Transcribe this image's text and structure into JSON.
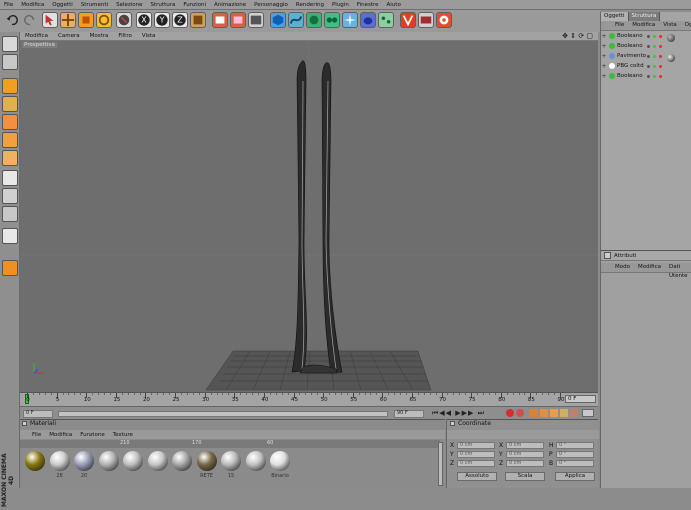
{
  "menubar": [
    "File",
    "Modifica",
    "Oggetti",
    "Strumenti",
    "Selezione",
    "Struttura",
    "Funzioni",
    "Animazione",
    "Personaggio",
    "Rendering",
    "Plugin",
    "Finestre",
    "Aiuto"
  ],
  "viewport": {
    "menu": [
      "Modifica",
      "Camera",
      "Mostra",
      "Filtro",
      "Vista"
    ],
    "label": "Prospettiva"
  },
  "timeline": {
    "ticks": [
      "0",
      "5",
      "10",
      "15",
      "20",
      "25",
      "30",
      "35",
      "40",
      "45",
      "50",
      "55",
      "60",
      "65",
      "70",
      "75",
      "80",
      "85",
      "90"
    ],
    "current_frame": "0 F",
    "start_frame": "0 F",
    "end_frame": "90 F"
  },
  "materials": {
    "title": "Materiali",
    "menu": [
      "File",
      "Modifica",
      "Funzione",
      "Texture"
    ],
    "items": [
      {
        "name": "",
        "color": "#8a7a10"
      },
      {
        "name": "28",
        "color": "#cccccc"
      },
      {
        "name": "20",
        "color": "#9aa0b8"
      },
      {
        "name": "",
        "color": "#b5b5b5"
      },
      {
        "name": "",
        "color": "#c0c0c0"
      },
      {
        "name": "",
        "color": "#c8c8c8"
      },
      {
        "name": "",
        "color": "#a9a9a9"
      },
      {
        "name": "RETE",
        "color": "#7a6a48"
      },
      {
        "name": "15",
        "color": "#bcbcbc"
      },
      {
        "name": "",
        "color": "#c4c4c4"
      },
      {
        "name": "Binario",
        "color": "#e0e0e0"
      }
    ],
    "headers": [
      "",
      "",
      "",
      "210",
      "",
      "",
      "",
      "170",
      "",
      "",
      "60",
      ""
    ]
  },
  "coords": {
    "title": "Coordinate",
    "rows": [
      {
        "axis": "X",
        "pos": "0 cm",
        "size": "0 cm",
        "rlabel": "H",
        "rot": "0 °"
      },
      {
        "axis": "Y",
        "pos": "0 cm",
        "size": "0 cm",
        "rlabel": "P",
        "rot": "0 °"
      },
      {
        "axis": "Z",
        "pos": "0 cm",
        "size": "0 cm",
        "rlabel": "B",
        "rot": "0 °"
      }
    ],
    "mode1": "Assoluto",
    "mode2": "Scala",
    "apply": "Applica"
  },
  "objects": {
    "tabs": [
      "Oggetti",
      "Struttura"
    ],
    "menu": [
      "File",
      "Modifica",
      "Vista",
      "Oggetti"
    ],
    "items": [
      {
        "name": "Booleano",
        "color": "#35c035"
      },
      {
        "name": "Booleano",
        "color": "#35c035"
      },
      {
        "name": "Pavimento",
        "color": "#6b8fd6"
      },
      {
        "name": "PBG coltd",
        "color": "#ffffff"
      },
      {
        "name": "Booleano",
        "color": "#35c035"
      }
    ]
  },
  "attributes": {
    "title": "Attributi",
    "menu": [
      "Modo",
      "Modifica",
      "Dati Utente"
    ]
  },
  "brand": "MAXON CINEMA 4D"
}
